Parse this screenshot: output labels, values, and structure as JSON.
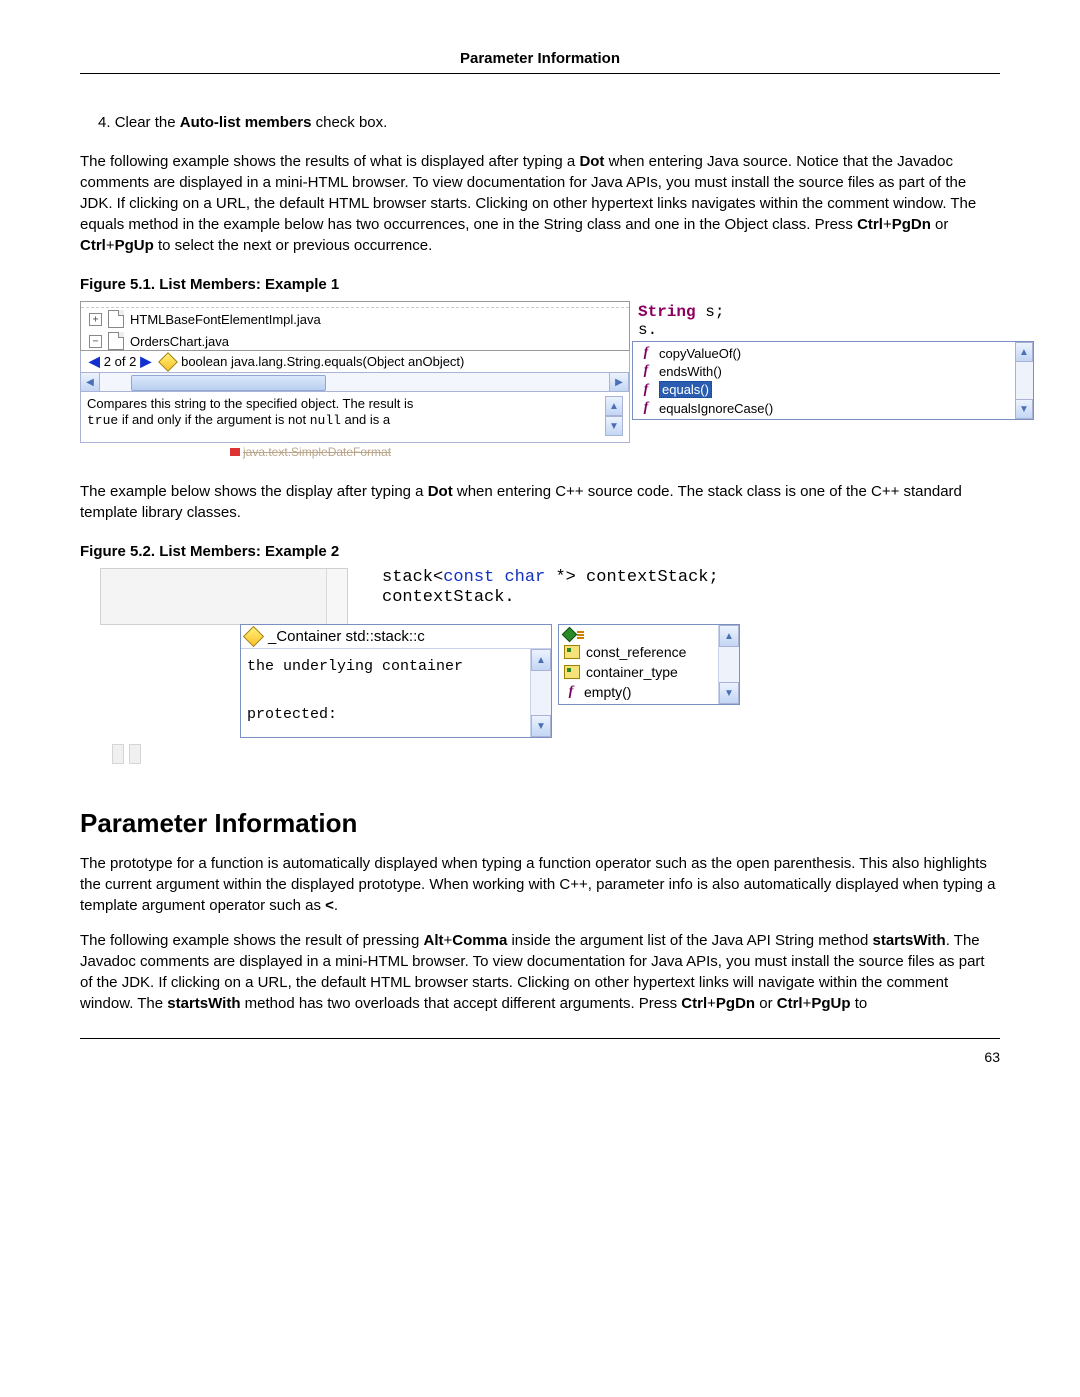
{
  "header": {
    "title": "Parameter Information"
  },
  "step4": {
    "num": "4. ",
    "pre": "Clear the ",
    "bold": "Auto-list members",
    "post": " check box."
  },
  "para1": {
    "t1": "The following example shows the results of what is displayed after typing a ",
    "dot": "Dot",
    "t2": " when entering Java source. Notice that the Javadoc comments are displayed in a mini-HTML browser. To view documentation for Java APIs, you must install the source files as part of the JDK. If clicking on a URL, the default HTML browser starts. Clicking on other hypertext links navigates within the comment window. The equals method in the example below has two occurrences, one in the String class and one in the Object class. Press ",
    "k1": "Ctrl",
    "plus1": "+",
    "k2": "PgDn",
    "or": " or ",
    "k3": "Ctrl",
    "plus2": "+",
    "k4": "PgUp",
    "t3": " to select the next or previous occurrence."
  },
  "fig1": {
    "caption": "Figure 5.1.  List Members: Example 1",
    "tree": {
      "row1": "HTMLBaseFontElementImpl.java",
      "row2": "OrdersChart.java"
    },
    "filter": {
      "counter": "2 of 2",
      "sig": "boolean java.lang.String.equals(Object anObject)"
    },
    "javadoc": {
      "line1a": "Compares this string to the specified object. The result is ",
      "line2a": "true",
      "line2b": " if and only if the argument is not ",
      "line2c": "null",
      "line2d": " and is a"
    },
    "ghost": "java.text.SimpleDateFormat",
    "code": {
      "kw": "String",
      "rest": " s;",
      "line2": "s."
    },
    "completion": [
      {
        "label": "copyValueOf()",
        "selected": false
      },
      {
        "label": "endsWith()",
        "selected": false
      },
      {
        "label": "equals()",
        "selected": true
      },
      {
        "label": "equalsIgnoreCase()",
        "selected": false
      }
    ]
  },
  "para2": {
    "t1": "The example below shows the display after typing a ",
    "dot": "Dot",
    "t2": " when entering C++ source code. The stack class is one of the C++ standard template library classes."
  },
  "fig2": {
    "caption": "Figure 5.2.  List Members: Example 2",
    "code": {
      "line1a": "stack<",
      "line1b": "const",
      "line1c": " ",
      "line1d": "char",
      "line1e": " *> contextStack;",
      "line2": "contextStack."
    },
    "info": {
      "head": "_Container std::stack::c",
      "body1": "the underlying container",
      "body2": "protected:"
    },
    "completion": [
      {
        "type": "sort",
        "label": ""
      },
      {
        "type": "type",
        "label": "const_reference"
      },
      {
        "type": "type",
        "label": "container_type"
      },
      {
        "type": "func",
        "label": "empty()"
      }
    ]
  },
  "section2": {
    "heading": "Parameter Information"
  },
  "para3": {
    "t1": "The prototype for a function is automatically displayed when typing a function operator such as the open parenthesis. This also highlights the current argument within the displayed prototype. When working with C++, parameter info is also automatically displayed when typing a template argument operator such as ",
    "lt": "<",
    "t2": "."
  },
  "para4": {
    "t1": "The following example shows the result of pressing ",
    "k1": "Alt",
    "plus": "+",
    "k2": "Comma",
    "t2": " inside the argument list of the Java API String method ",
    "m1": "startsWith",
    "t3": ". The Javadoc comments are displayed in a mini-HTML browser. To view documentation for Java APIs, you must install the source files as part of the JDK. If clicking on a URL, the default HTML browser starts. Clicking on other hypertext links will navigate within the comment window. The ",
    "m2": "startsWith",
    "t4": " method has two overloads that accept different arguments. Press ",
    "k3": "Ctrl",
    "plus2": "+",
    "k4": "PgDn",
    "or": " or ",
    "k5": "Ctrl",
    "plus3": "+",
    "k6": "PgUp",
    "t5": " to"
  },
  "page_number": "63"
}
